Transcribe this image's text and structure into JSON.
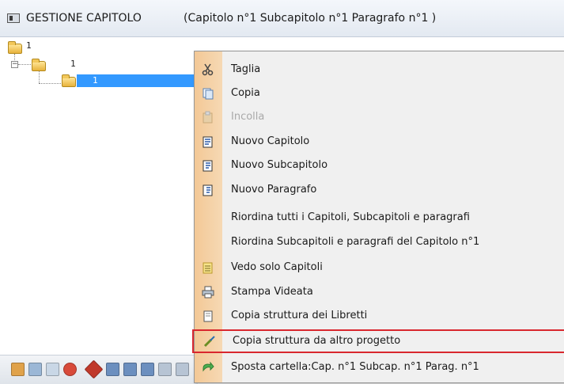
{
  "window": {
    "title": "GESTIONE CAPITOLO",
    "subtitle": "(Capitolo n°1  Subcapitolo n°1  Paragrafo n°1 )"
  },
  "tree": {
    "root_label": "1",
    "child_label": "1",
    "selected_label": "1"
  },
  "context_menu": {
    "items": [
      {
        "label": "Taglia",
        "icon": "scissors-icon",
        "enabled": true
      },
      {
        "label": "Copia",
        "icon": "copy-icon",
        "enabled": true
      },
      {
        "label": "Incolla",
        "icon": "paste-icon",
        "enabled": false
      },
      {
        "label": "Nuovo Capitolo",
        "icon": "new-chapter-icon",
        "enabled": true
      },
      {
        "label": "Nuovo Subcapitolo",
        "icon": "new-subchapter-icon",
        "enabled": true
      },
      {
        "label": "Nuovo Paragrafo",
        "icon": "new-paragraph-icon",
        "enabled": true
      },
      {
        "label": "Riordina tutti i Capitoli, Subcapitoli e paragrafi",
        "icon": "",
        "enabled": true
      },
      {
        "label": "Riordina Subcapitoli e paragrafi del Capitolo n°1",
        "icon": "",
        "enabled": true
      },
      {
        "label": "Vedo solo Capitoli",
        "icon": "chapters-only-icon",
        "enabled": true
      },
      {
        "label": "Stampa Videata",
        "icon": "print-icon",
        "enabled": true
      },
      {
        "label": "Copia struttura dei Libretti",
        "icon": "copy-booklet-structure-icon",
        "enabled": true
      },
      {
        "label": "Copia struttura da altro progetto",
        "icon": "copy-from-project-icon",
        "enabled": true,
        "highlighted": true
      },
      {
        "label": "Sposta cartella:Cap. n°1 Subcap. n°1 Parag. n°1",
        "icon": "move-folder-icon",
        "enabled": true
      }
    ]
  },
  "colors": {
    "selection": "#3399ff",
    "gutter": "#f3c896",
    "highlight_border": "#d9272e",
    "disabled_text": "#a9a9a9"
  }
}
